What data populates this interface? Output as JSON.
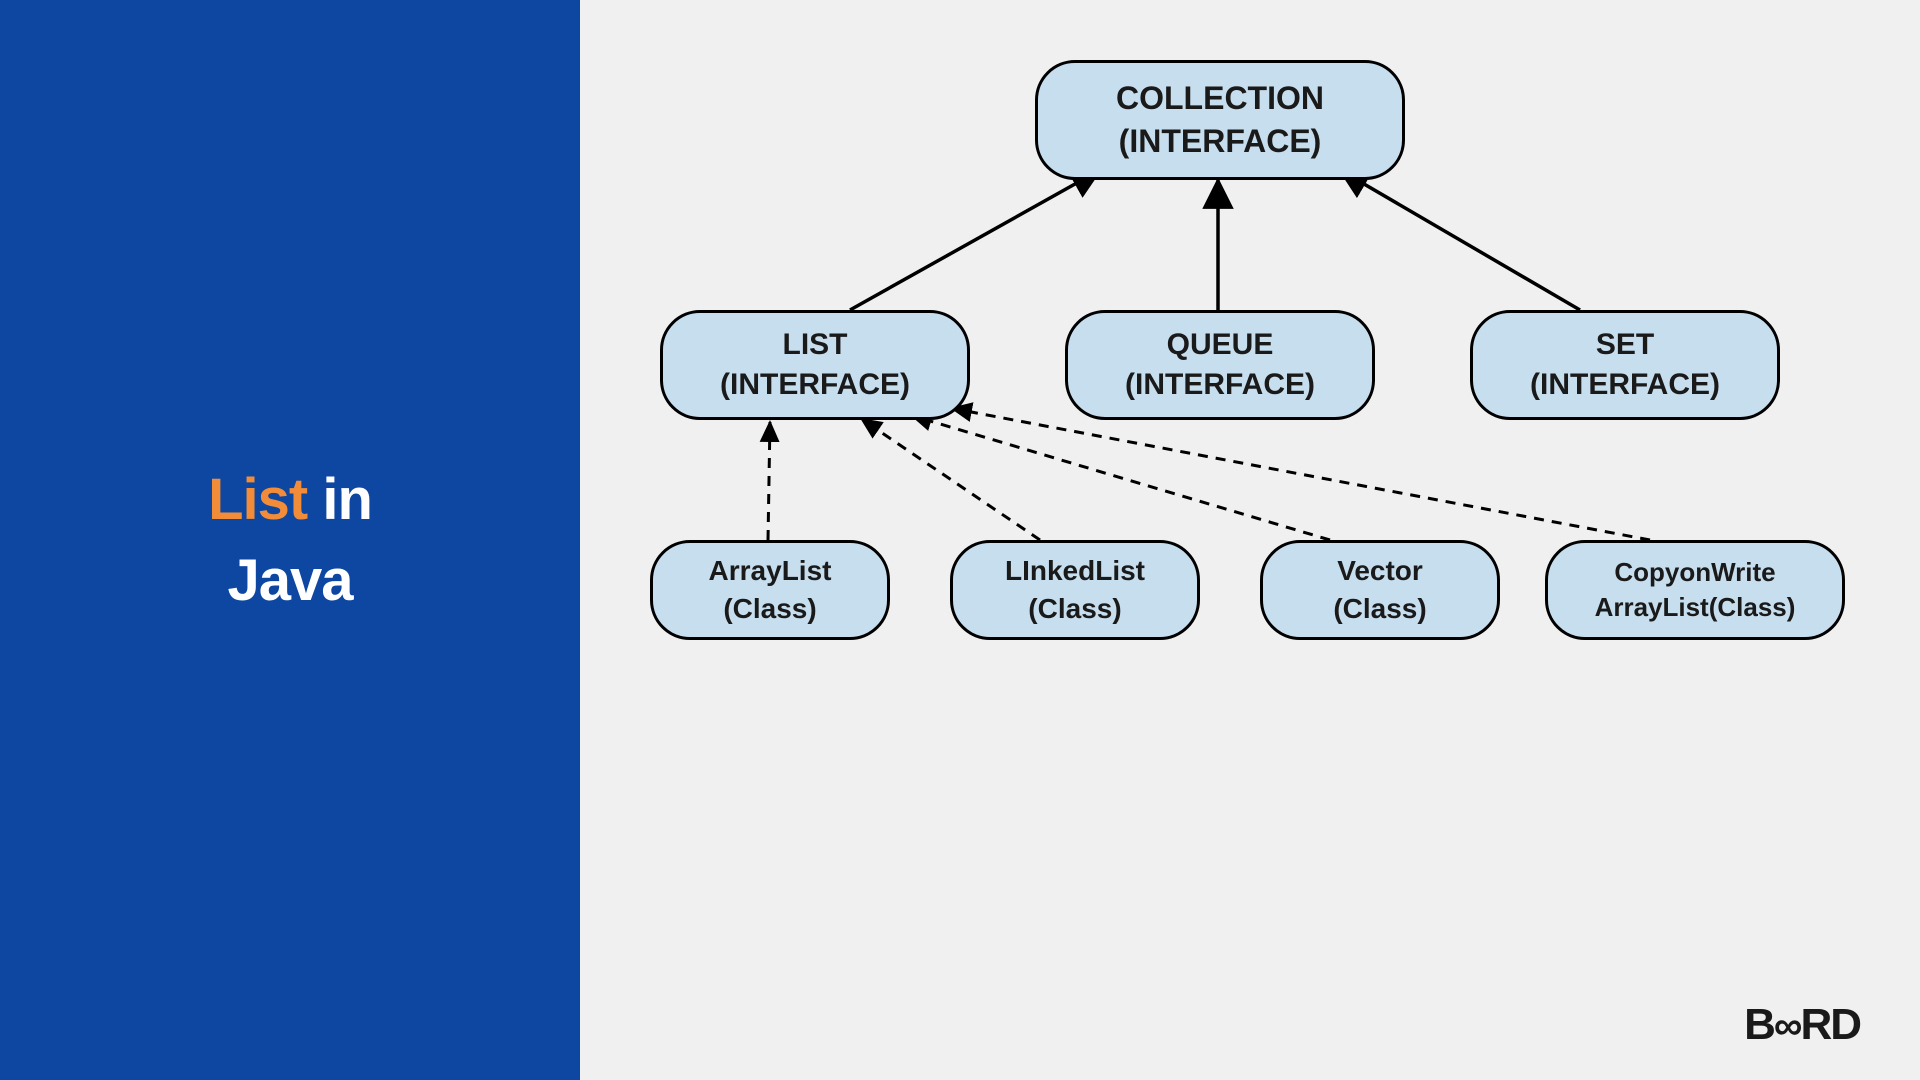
{
  "sidebar": {
    "accent_word": "List",
    "rest_line1": " in",
    "line2": "Java"
  },
  "logo": {
    "part1": "B",
    "infinity": "∞",
    "part2": "RD"
  },
  "nodes": {
    "collection": {
      "line1": "COLLECTION",
      "line2": "(INTERFACE)"
    },
    "list": {
      "line1": "LIST",
      "line2": "(INTERFACE)"
    },
    "queue": {
      "line1": "QUEUE",
      "line2": "(INTERFACE)"
    },
    "set": {
      "line1": "SET",
      "line2": "(INTERFACE)"
    },
    "arraylist": {
      "line1": "ArrayList",
      "line2": "(Class)"
    },
    "linkedlist": {
      "line1": "LInkedList",
      "line2": "(Class)"
    },
    "vector": {
      "line1": "Vector",
      "line2": "(Class)"
    },
    "cowal": {
      "line1": "CopyonWrite",
      "line2": "ArrayList(Class)"
    }
  },
  "edges_solid": [
    {
      "from": "list",
      "to": "collection"
    },
    {
      "from": "queue",
      "to": "collection"
    },
    {
      "from": "set",
      "to": "collection"
    }
  ],
  "edges_dashed": [
    {
      "from": "arraylist",
      "to": "list"
    },
    {
      "from": "linkedlist",
      "to": "list"
    },
    {
      "from": "vector",
      "to": "list"
    },
    {
      "from": "cowal",
      "to": "list"
    }
  ],
  "colors": {
    "sidebar_bg": "#0d47a1",
    "accent": "#f28c38",
    "node_fill": "#c7deef",
    "node_border": "#000000",
    "page_bg": "#f0f0f0"
  }
}
